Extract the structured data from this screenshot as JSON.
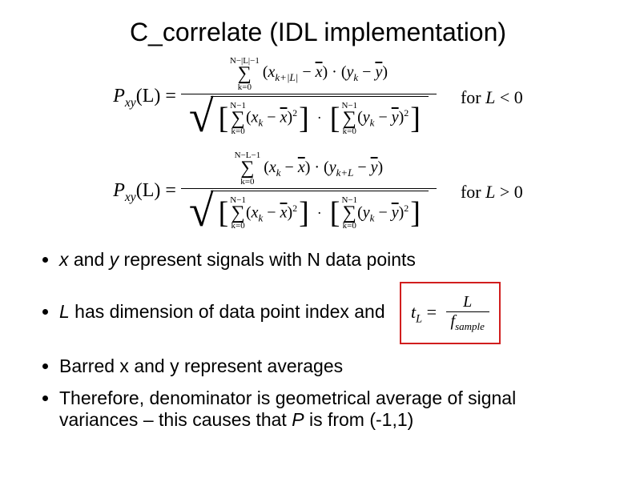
{
  "title": "C_correlate (IDL implementation)",
  "formulas": {
    "lhs": "P",
    "lhs_sub": "xy",
    "arg": "(L) =",
    "cond_neg": "for L < 0",
    "cond_pos": "for L > 0",
    "sum_upper_neg": "N−|L|−1",
    "sum_upper_pos": "N−L−1",
    "sum_upper_den": "N−1",
    "sum_lower": "k=0",
    "num_term_neg": "(x_{k+|L|} − x̄) · (y_k − ȳ)",
    "num_term_pos": "(x_k − x̄) · (y_{k+L} − ȳ)",
    "den_x": "(x_k − x̄)^2",
    "den_y": "(y_k − ȳ)^2"
  },
  "bullets": [
    {
      "text_pre_it1": "",
      "it1": "x",
      "mid1": " and ",
      "it2": "y",
      "text_post": " represent signals with N data points"
    },
    {
      "it1": "L",
      "text_post": " has dimension of data point index and"
    },
    {
      "text": "Barred x and y represent averages"
    },
    {
      "text_pre": "Therefore, denominator is geometrical average of signal variances – this causes that ",
      "it1": "P",
      "text_post": " is from (-1,1)"
    }
  ],
  "tl_box": {
    "lhs": "t",
    "lhs_sub": "L",
    "eq": " = ",
    "num": "L",
    "den_f": "f",
    "den_sub": "sample"
  }
}
